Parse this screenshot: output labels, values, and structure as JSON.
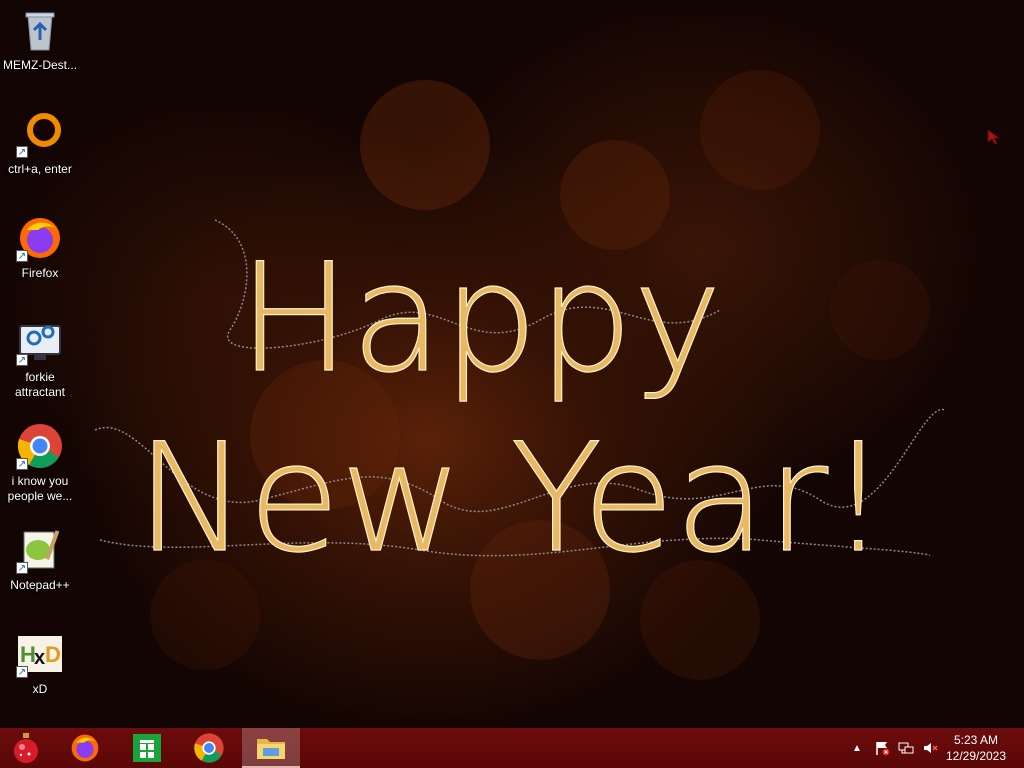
{
  "wallpaper": {
    "line1": "Happy",
    "line2": "New Year!",
    "colors": {
      "lights": "#e9b865",
      "background": "#140604"
    }
  },
  "desktop_icons": [
    {
      "label": "MEMZ-Dest...",
      "icon": "recycle-bin-icon"
    },
    {
      "label": "ctrl+a, enter",
      "icon": "orange-ring-icon"
    },
    {
      "label": "Firefox",
      "icon": "firefox-icon"
    },
    {
      "label": "forkie attractant",
      "icon": "monitor-gears-icon"
    },
    {
      "label": "i know you people we...",
      "icon": "chrome-icon"
    },
    {
      "label": "Notepad++",
      "icon": "notepad-plus-plus-icon"
    },
    {
      "label": "xD",
      "icon": "hxd-icon"
    }
  ],
  "taskbar": {
    "start_icon": "ornament-start-icon",
    "pinned": [
      "firefox-icon",
      "store-icon",
      "chrome-icon",
      "file-explorer-icon"
    ],
    "tray_icons": [
      "show-hidden-icons-chevron",
      "action-center-flag-icon",
      "network-icon",
      "volume-muted-icon"
    ],
    "clock": {
      "time": "5:23 AM",
      "date": "12/29/2023"
    },
    "color": "#6d0c0c"
  }
}
